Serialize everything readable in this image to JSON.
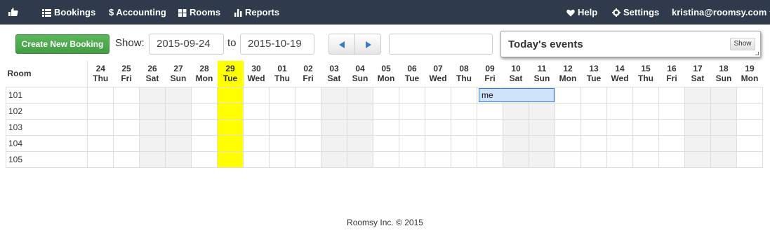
{
  "navbar": {
    "brand_icon": "hand-icon",
    "items": [
      {
        "label": "Bookings",
        "icon": "list-icon"
      },
      {
        "label": "$ Accounting",
        "icon": ""
      },
      {
        "label": "Rooms",
        "icon": "grid-icon"
      },
      {
        "label": "Reports",
        "icon": "bar-chart-icon"
      }
    ],
    "help": "Help",
    "settings": "Settings",
    "user": "kristina@roomsy.com"
  },
  "toolbar": {
    "create_label": "Create New Booking",
    "show_label": "Show:",
    "date_from": "2015-09-24",
    "to_label": "to",
    "date_to": "2015-10-19",
    "search_value": ""
  },
  "events": {
    "title": "Today's events",
    "show_label": "Show"
  },
  "calendar": {
    "room_header": "Room",
    "days": [
      {
        "date": "24",
        "dow": "Thu"
      },
      {
        "date": "25",
        "dow": "Fri"
      },
      {
        "date": "26",
        "dow": "Sat"
      },
      {
        "date": "27",
        "dow": "Sun"
      },
      {
        "date": "28",
        "dow": "Mon"
      },
      {
        "date": "29",
        "dow": "Tue"
      },
      {
        "date": "30",
        "dow": "Wed"
      },
      {
        "date": "01",
        "dow": "Thu"
      },
      {
        "date": "02",
        "dow": "Fri"
      },
      {
        "date": "03",
        "dow": "Sat"
      },
      {
        "date": "04",
        "dow": "Sun"
      },
      {
        "date": "05",
        "dow": "Mon"
      },
      {
        "date": "06",
        "dow": "Tue"
      },
      {
        "date": "07",
        "dow": "Wed"
      },
      {
        "date": "08",
        "dow": "Thu"
      },
      {
        "date": "09",
        "dow": "Fri"
      },
      {
        "date": "10",
        "dow": "Sat"
      },
      {
        "date": "11",
        "dow": "Sun"
      },
      {
        "date": "12",
        "dow": "Mon"
      },
      {
        "date": "13",
        "dow": "Tue"
      },
      {
        "date": "14",
        "dow": "Wed"
      },
      {
        "date": "15",
        "dow": "Thu"
      },
      {
        "date": "16",
        "dow": "Fri"
      },
      {
        "date": "17",
        "dow": "Sat"
      },
      {
        "date": "18",
        "dow": "Sun"
      },
      {
        "date": "19",
        "dow": "Mon"
      }
    ],
    "today_index": 5,
    "rooms": [
      "101",
      "102",
      "103",
      "104",
      "105"
    ],
    "bookings": [
      {
        "room": "101",
        "start_index": 15,
        "nights": 3,
        "label": "me"
      }
    ],
    "colors": {
      "today": "#ffff00",
      "weekend": "#f2f2f2",
      "booking": "#cfe3fb",
      "booking_border": "#3a7fd5"
    }
  },
  "footer": {
    "text": "Roomsy Inc. © 2015"
  }
}
